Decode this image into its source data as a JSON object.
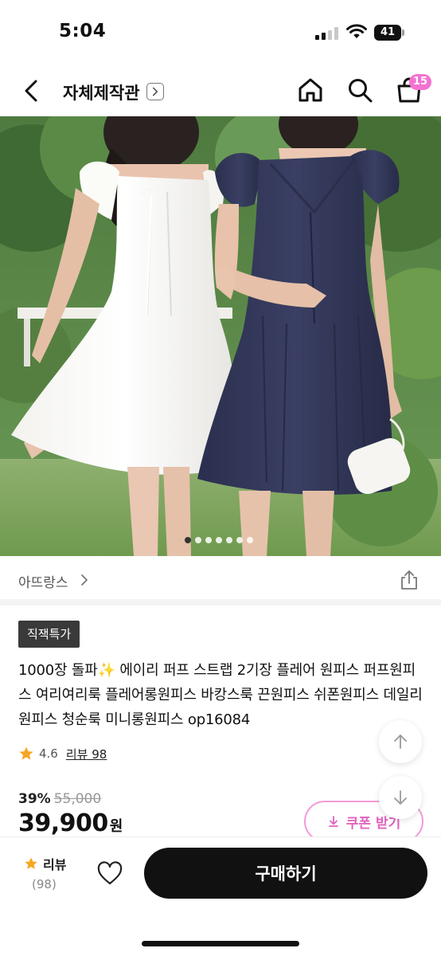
{
  "status_bar": {
    "time": "5:04",
    "battery": "41"
  },
  "header": {
    "store_title": "자체제작관",
    "cart_count": "15"
  },
  "hero": {
    "image_count": 7,
    "active_index": 0
  },
  "brand": {
    "name": "아뜨랑스"
  },
  "product": {
    "tag": "직잭특가",
    "title": "1000장 돌파✨ 에이리 퍼프 스트랩 2기장 플레어 원피스 퍼프원피스 여리여리룩 플레어롱원피스 바캉스룩 끈원피스 쉬폰원피스 데일리원피스 청순룩 미니롱원피스 op16084",
    "rating": "4.6",
    "review_link": "리뷰 98",
    "discount_rate": "39%",
    "original_price": "55,000",
    "price": "39,900",
    "currency": "원",
    "coupon_label": "쿠폰 받기"
  },
  "bottom_bar": {
    "review_label": "리뷰",
    "review_count": "(98)",
    "buy_label": "구매하기"
  },
  "icons": {
    "back": "chevron-left-icon",
    "home": "home-icon",
    "search": "search-icon",
    "cart": "shopping-bag-icon",
    "share": "share-icon",
    "star": "star-icon",
    "heart": "heart-icon",
    "arrow_up": "arrow-up-icon",
    "arrow_down": "arrow-down-icon",
    "download": "download-icon"
  },
  "colors": {
    "accent_pink": "#f472d0",
    "coupon_pink": "#e262bf",
    "star": "#f5a623",
    "buy_button": "#111111"
  }
}
